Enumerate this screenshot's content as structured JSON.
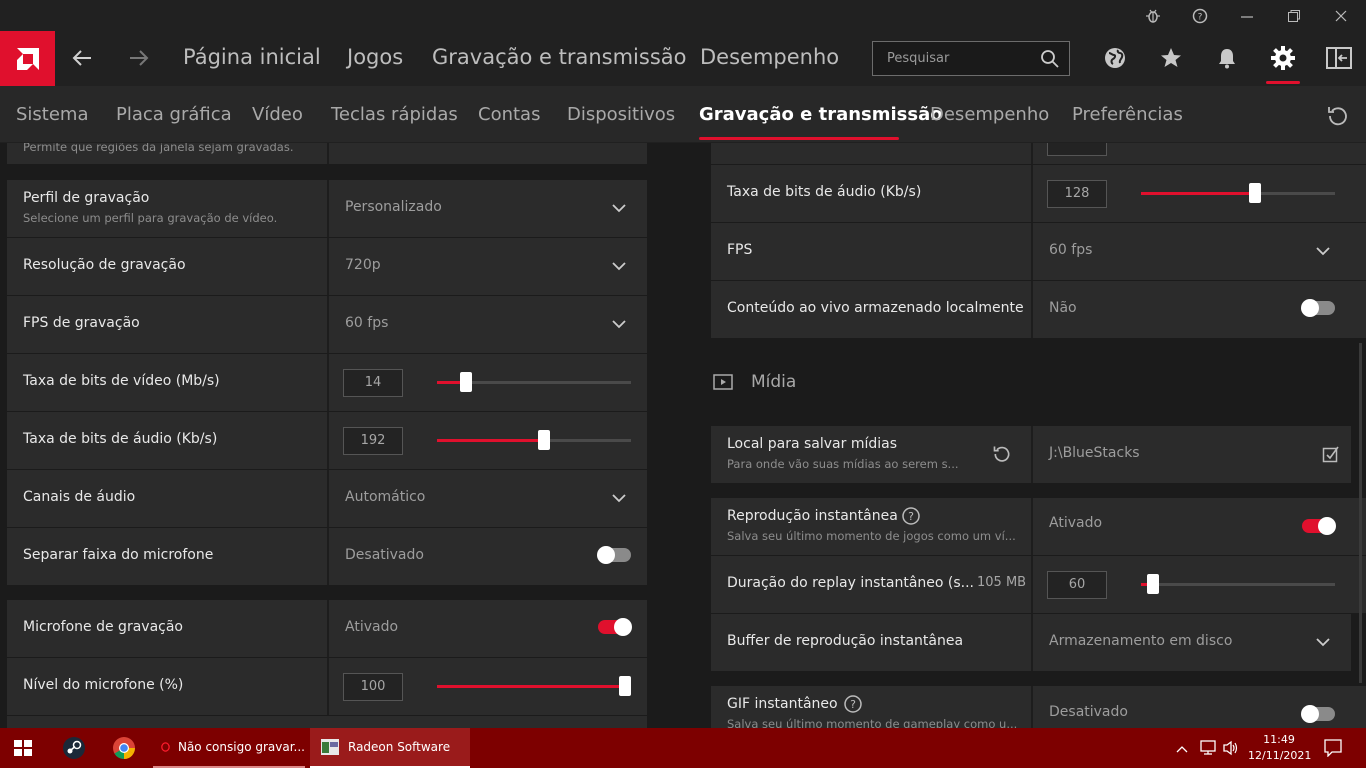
{
  "nav": {
    "links": [
      "Página inicial",
      "Jogos",
      "Gravação e transmissão",
      "Desempenho"
    ],
    "search_placeholder": "Pesquisar"
  },
  "subnav": {
    "tabs": [
      "Sistema",
      "Placa gráfica",
      "Vídeo",
      "Teclas rápidas",
      "Contas",
      "Dispositivos",
      "Gravação e transmissão",
      "Desempenho",
      "Preferências"
    ],
    "active_index": 6
  },
  "left": {
    "partial_sub": "Permite que regiões da janela sejam gravadas.",
    "profile": {
      "label": "Perfil de gravação",
      "sub": "Selecione um perfil para gravação de vídeo.",
      "value": "Personalizado"
    },
    "resolution": {
      "label": "Resolução de gravação",
      "value": "720p"
    },
    "fps": {
      "label": "FPS de gravação",
      "value": "60 fps"
    },
    "video_bitrate": {
      "label": "Taxa de bits de vídeo (Mb/s)",
      "value": "14",
      "fraction": 0.15
    },
    "audio_bitrate": {
      "label": "Taxa de bits de áudio (Kb/s)",
      "value": "192",
      "fraction": 0.55
    },
    "audio_channels": {
      "label": "Canais de áudio",
      "value": "Automático"
    },
    "separate_mic": {
      "label": "Separar faixa do microfone",
      "value": "Desativado",
      "on": false
    },
    "rec_mic": {
      "label": "Microfone de gravação",
      "value": "Ativado",
      "on": true
    },
    "mic_level": {
      "label": "Nível do microfone (%)",
      "value": "100",
      "fraction": 1.0
    }
  },
  "right": {
    "audio_bitrate": {
      "label": "Taxa de bits de áudio (Kb/s)",
      "value": "128",
      "fraction": 0.59
    },
    "fps": {
      "label": "FPS",
      "value": "60 fps"
    },
    "local_content": {
      "label": "Conteúdo ao vivo armazenado localmente",
      "value": "Não",
      "on": false
    },
    "media_section": "Mídia",
    "save_location": {
      "label": "Local para salvar mídias",
      "sub": "Para onde vão suas mídias ao serem s...",
      "value": "J:\\BlueStacks"
    },
    "instant_replay": {
      "label": "Reprodução instantânea",
      "sub": "Salva seu último momento de jogos como um ví...",
      "value": "Ativado",
      "on": true
    },
    "replay_duration": {
      "label": "Duração do replay instantâneo (s...",
      "mem": "105 MB",
      "value": "60",
      "fraction": 0.06
    },
    "replay_buffer": {
      "label": "Buffer de reprodução instantânea",
      "value": "Armazenamento em disco"
    },
    "instant_gif": {
      "label": "GIF instantâneo",
      "sub": "Salva seu último momento de gameplay como u...",
      "value": "Desativado",
      "on": false
    }
  },
  "taskbar": {
    "apps": [
      "Não consigo gravar...",
      "Radeon Software"
    ],
    "time": "11:49",
    "date": "12/11/2021"
  },
  "colors": {
    "accent": "#e0102d",
    "taskbar": "#7d0000"
  }
}
